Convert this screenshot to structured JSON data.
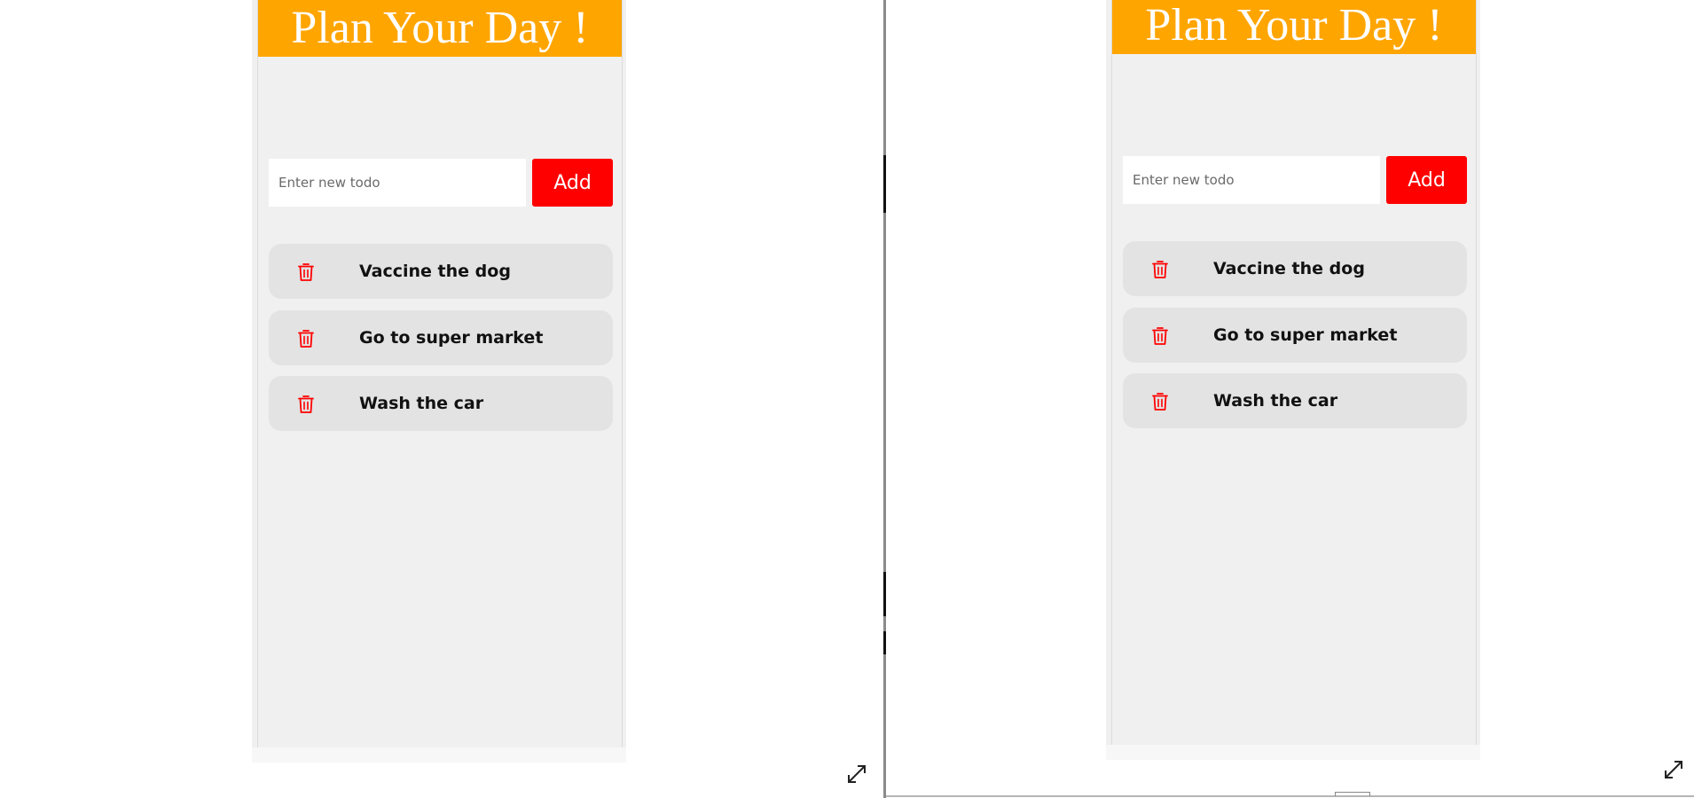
{
  "app": {
    "title": "Plan Your Day !",
    "input_placeholder": "Enter new todo",
    "add_label": "Add",
    "todos": [
      {
        "label": "Vaccine the dog"
      },
      {
        "label": "Go to super market"
      },
      {
        "label": "Wash the car"
      }
    ]
  },
  "icons": {
    "delete": "trash-icon",
    "fullscreen": "expand-icon"
  },
  "colors": {
    "header": "#ffa500",
    "accent": "#ff0000",
    "item_bg": "#e3e3e3",
    "app_bg": "#f0f0f0"
  }
}
